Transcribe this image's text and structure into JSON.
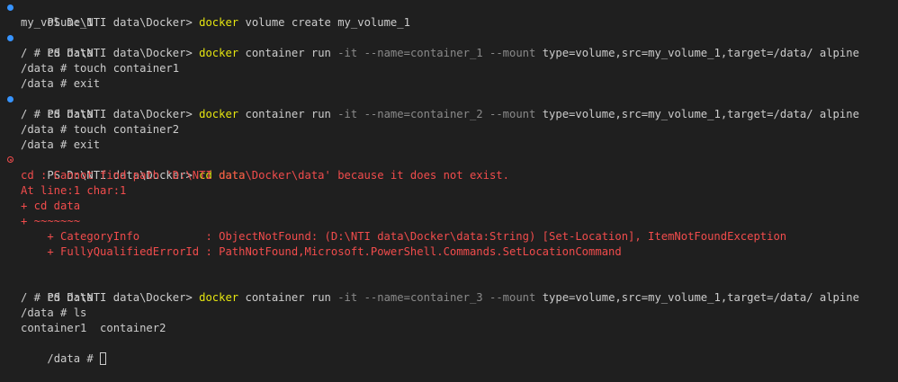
{
  "prompt": "PS D:\\NTI data\\Docker> ",
  "exe": "docker",
  "cmd1": {
    "rest": " volume create my_volume_1",
    "output": "my_volume_1"
  },
  "cmd2": {
    "a": " container run ",
    "p1": "-it --name=",
    "b": "container_1 ",
    "p2": "--mount",
    "c": " type=volume,src=my_volume_1,target=/data/ alpine",
    "out": [
      "/ # cd data",
      "/data # touch container1",
      "/data # exit"
    ]
  },
  "cmd3": {
    "a": " container run ",
    "p1": "-it --name=",
    "b": "container_2 ",
    "p2": "--mount",
    "c": " type=volume,src=my_volume_1,target=/data/ alpine",
    "out": [
      "/ # cd data",
      "/data # touch container2",
      "/data # exit"
    ]
  },
  "cmd4": {
    "text": "cd data",
    "errors": [
      "cd : Cannot find path 'D:\\NTI data\\Docker\\data' because it does not exist.",
      "At line:1 char:1",
      "+ cd data",
      "+ ~~~~~~~",
      "    + CategoryInfo          : ObjectNotFound: (D:\\NTI data\\Docker\\data:String) [Set-Location], ItemNotFoundException",
      "    + FullyQualifiedErrorId : PathNotFound,Microsoft.PowerShell.Commands.SetLocationCommand"
    ]
  },
  "cmd5": {
    "a": " container run ",
    "p1": "-it --name=",
    "b": "container_3 ",
    "p2": "--mount",
    "c": " type=volume,src=my_volume_1,target=/data/ alpine",
    "out": [
      "/ # cd data",
      "/data # ls",
      "container1  container2"
    ],
    "last_prompt": "/data # "
  },
  "colors": {
    "executable": "#e5e510",
    "error": "#f14c4c",
    "success_marker": "#3794ff",
    "param": "#8a8a8a"
  }
}
